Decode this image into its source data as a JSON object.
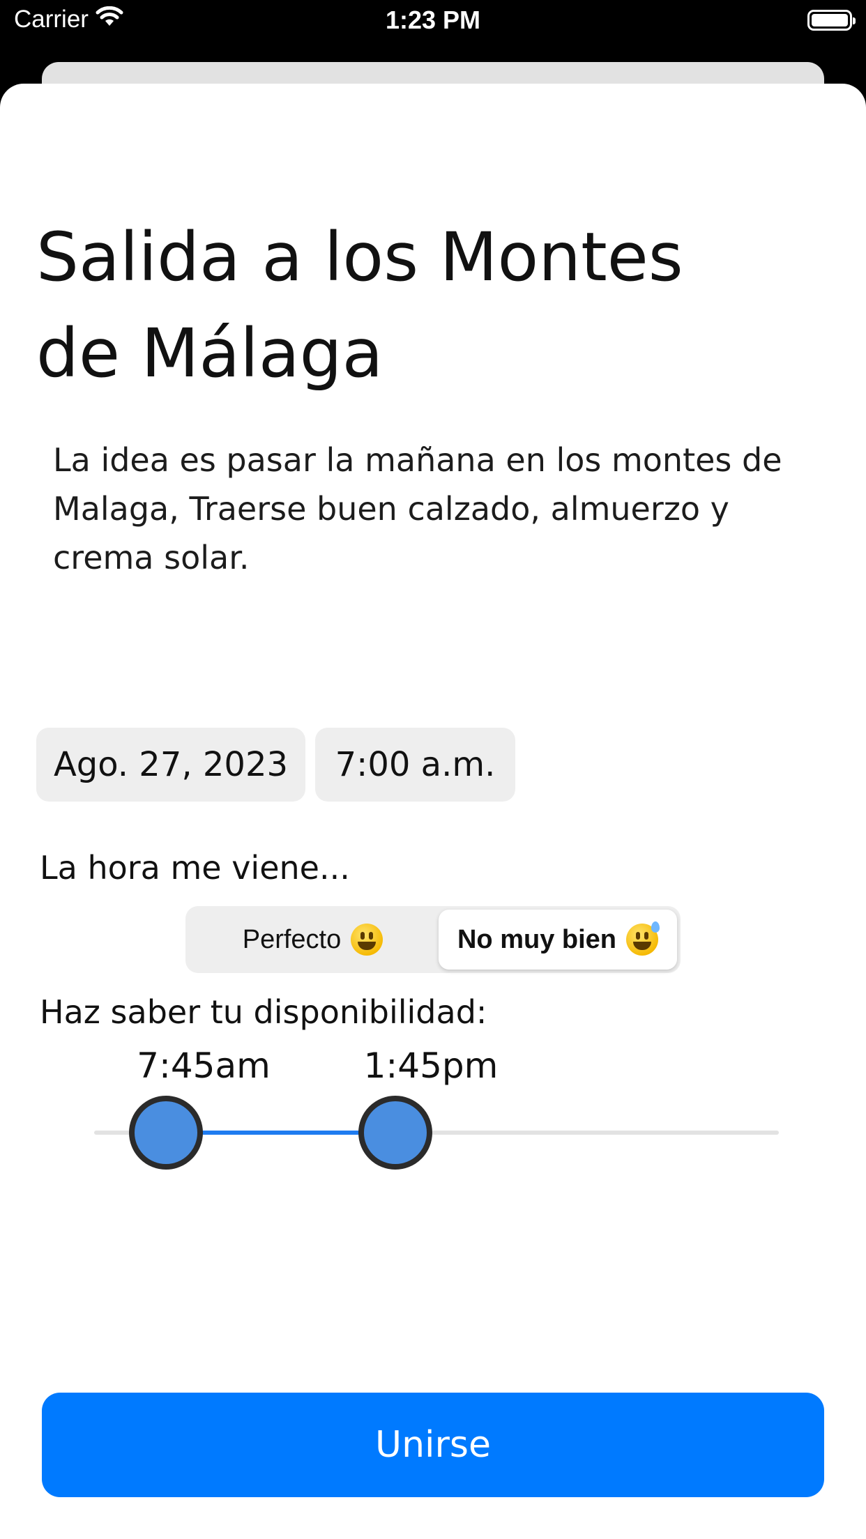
{
  "status_bar": {
    "carrier": "Carrier",
    "time": "1:23 PM"
  },
  "event": {
    "title": "Salida a los Montes de Málaga",
    "description": "La idea es pasar la mañana en los montes de Malaga, Traerse buen calzado, almuerzo y crema solar.",
    "date": "Ago. 27, 2023",
    "time": "7:00 a.m."
  },
  "time_feedback": {
    "label": "La hora me viene...",
    "options": [
      {
        "label": "Perfecto",
        "icon": "grinning-face-emoji"
      },
      {
        "label": "No muy bien",
        "icon": "grinning-face-sweat-emoji"
      }
    ],
    "selected_index": 1
  },
  "availability": {
    "label": "Haz saber tu disponibilidad:",
    "low_label": "7:45am",
    "high_label": "1:45pm",
    "low_fraction": 0.105,
    "high_fraction": 0.44
  },
  "actions": {
    "join_label": "Unirse"
  },
  "colors": {
    "accent": "#007aff",
    "slider_active": "#1f7cf0",
    "thumb_fill": "#4a8ee0"
  }
}
